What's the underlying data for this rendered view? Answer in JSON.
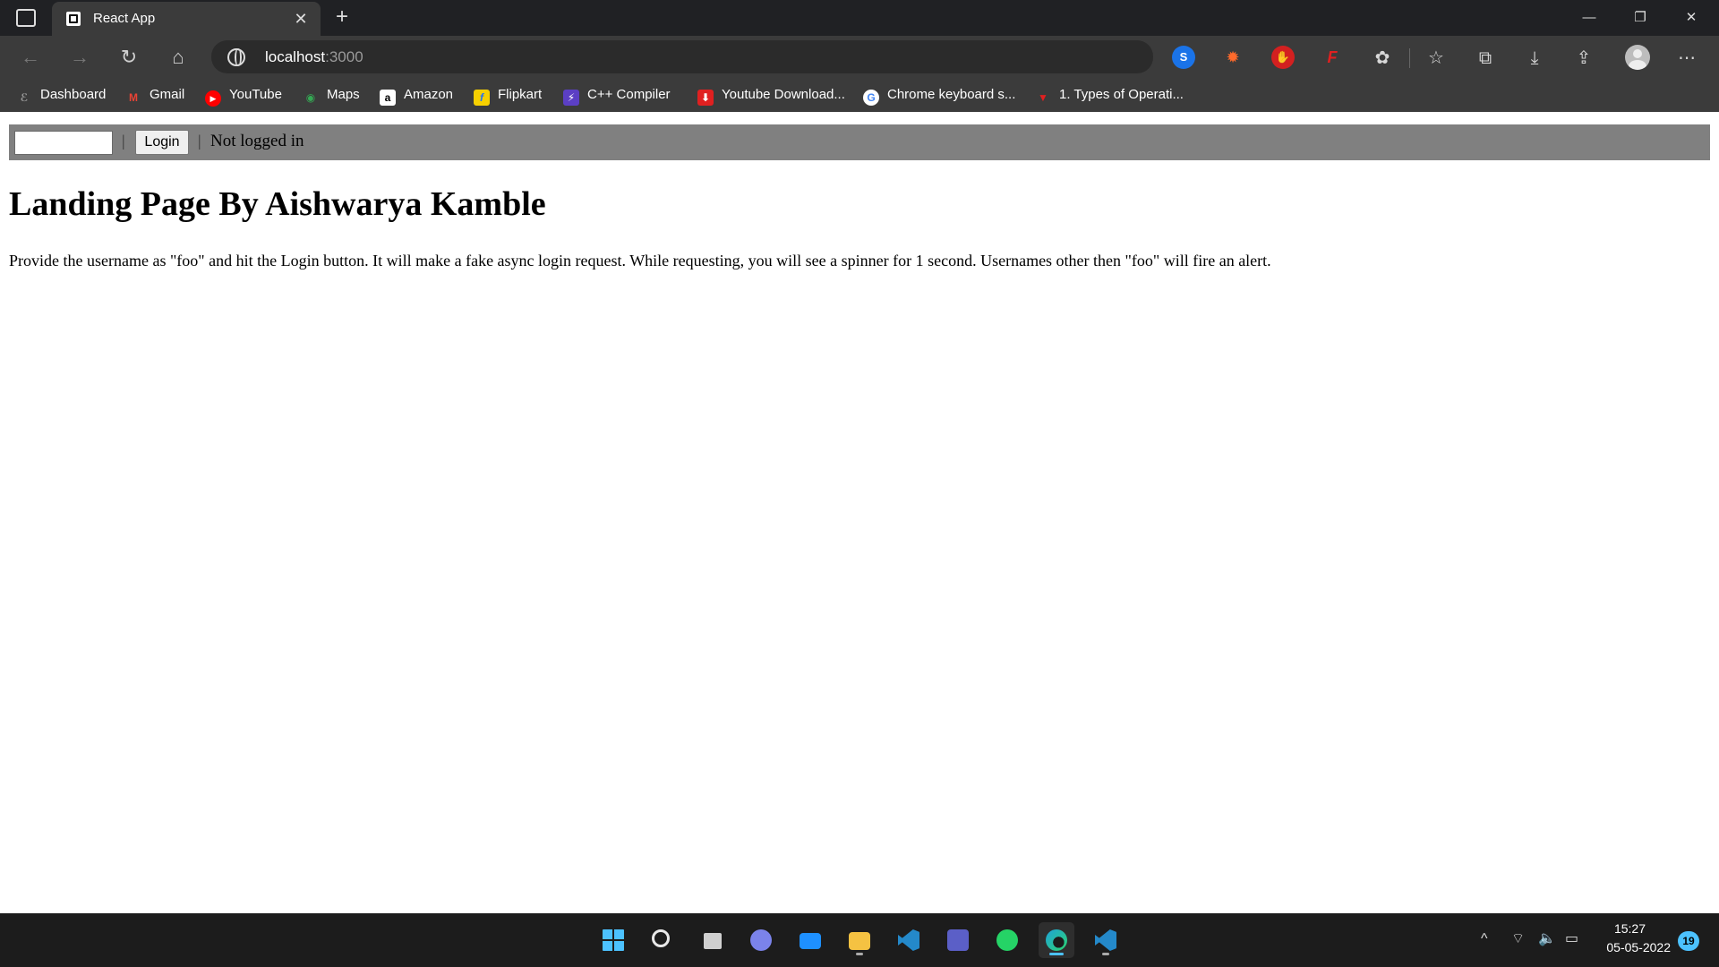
{
  "browser": {
    "tab": {
      "title": "React App",
      "close_glyph": "✕"
    },
    "new_tab_glyph": "+",
    "window_controls": {
      "minimize": "—",
      "maximize": "❐",
      "close": "✕"
    },
    "nav": {
      "back": "←",
      "forward": "→",
      "refresh": "↻",
      "home": "⌂"
    },
    "address": {
      "host": "localhost",
      "port": ":3000"
    },
    "extensions": [
      {
        "name": "shazam-extension-icon",
        "glyph": "S"
      },
      {
        "name": "bug-extension-icon",
        "glyph": "✹"
      },
      {
        "name": "adblock-extension-icon",
        "glyph": "✋"
      },
      {
        "name": "flash-extension-icon",
        "glyph": "F"
      }
    ],
    "toolbar_icons": {
      "extensions": "✿",
      "favorites": "☆",
      "collections": "⧉",
      "downloads": "⤓",
      "share": "⇪",
      "more": "⋯"
    },
    "bookmarks": [
      {
        "label": "Dashboard",
        "icon": "dashboard-icon",
        "color": "#3b3b3b",
        "glyph": "ℰ"
      },
      {
        "label": "Gmail",
        "icon": "gmail-icon",
        "color": "#3b3b3b",
        "glyph": "M"
      },
      {
        "label": "YouTube",
        "icon": "youtube-icon",
        "color": "#ff0000",
        "glyph": "▶"
      },
      {
        "label": "Maps",
        "icon": "maps-icon",
        "color": "#3b3b3b",
        "glyph": "◉"
      },
      {
        "label": "Amazon",
        "icon": "amazon-icon",
        "color": "#ffffff",
        "glyph": "a"
      },
      {
        "label": "Flipkart",
        "icon": "flipkart-icon",
        "color": "#f7d000",
        "glyph": "f"
      },
      {
        "label": "C++ Compiler",
        "icon": "compiler-icon",
        "color": "#5b3fc4",
        "glyph": "⚡"
      },
      {
        "label": "Youtube Download...",
        "icon": "download-icon",
        "color": "#e02020",
        "glyph": "⬇"
      },
      {
        "label": "Chrome keyboard s...",
        "icon": "google-icon",
        "color": "#ffffff",
        "glyph": "G"
      },
      {
        "label": "1. Types of Operati...",
        "icon": "tutorial-icon",
        "color": "#3b3b3b",
        "glyph": "▼"
      }
    ]
  },
  "page": {
    "username_value": "",
    "login_button": "Login",
    "separator": "|",
    "status": "Not logged in",
    "heading": "Landing Page By Aishwarya Kamble",
    "description": "Provide the username as \"foo\" and hit the Login button. It will make a fake async login request. While requesting, you will see a spinner for 1 second. Usernames other then \"foo\" will fire an alert."
  },
  "taskbar": {
    "apps": [
      {
        "name": "start-icon",
        "color": "#4cc2ff"
      },
      {
        "name": "search-icon",
        "color": "#1c1c1c"
      },
      {
        "name": "task-view-icon",
        "color": "#d0d0d0"
      },
      {
        "name": "chat-icon",
        "color": "#7b83eb"
      },
      {
        "name": "mail-icon",
        "color": "#1e90ff"
      },
      {
        "name": "file-explorer-icon",
        "color": "#f5c242"
      },
      {
        "name": "vscode-icon",
        "color": "#2489ca"
      },
      {
        "name": "teams-icon",
        "color": "#5b5fc7"
      },
      {
        "name": "whatsapp-icon",
        "color": "#25d366"
      },
      {
        "name": "edge-icon",
        "color": "#1fa3d9"
      },
      {
        "name": "vscode-2-icon",
        "color": "#2489ca"
      }
    ],
    "tray": {
      "chevron": "^",
      "wifi": "⌔",
      "volume": "🔈",
      "battery": "▭"
    },
    "time": "15:27",
    "date": "05-05-2022",
    "notifications": "19"
  }
}
